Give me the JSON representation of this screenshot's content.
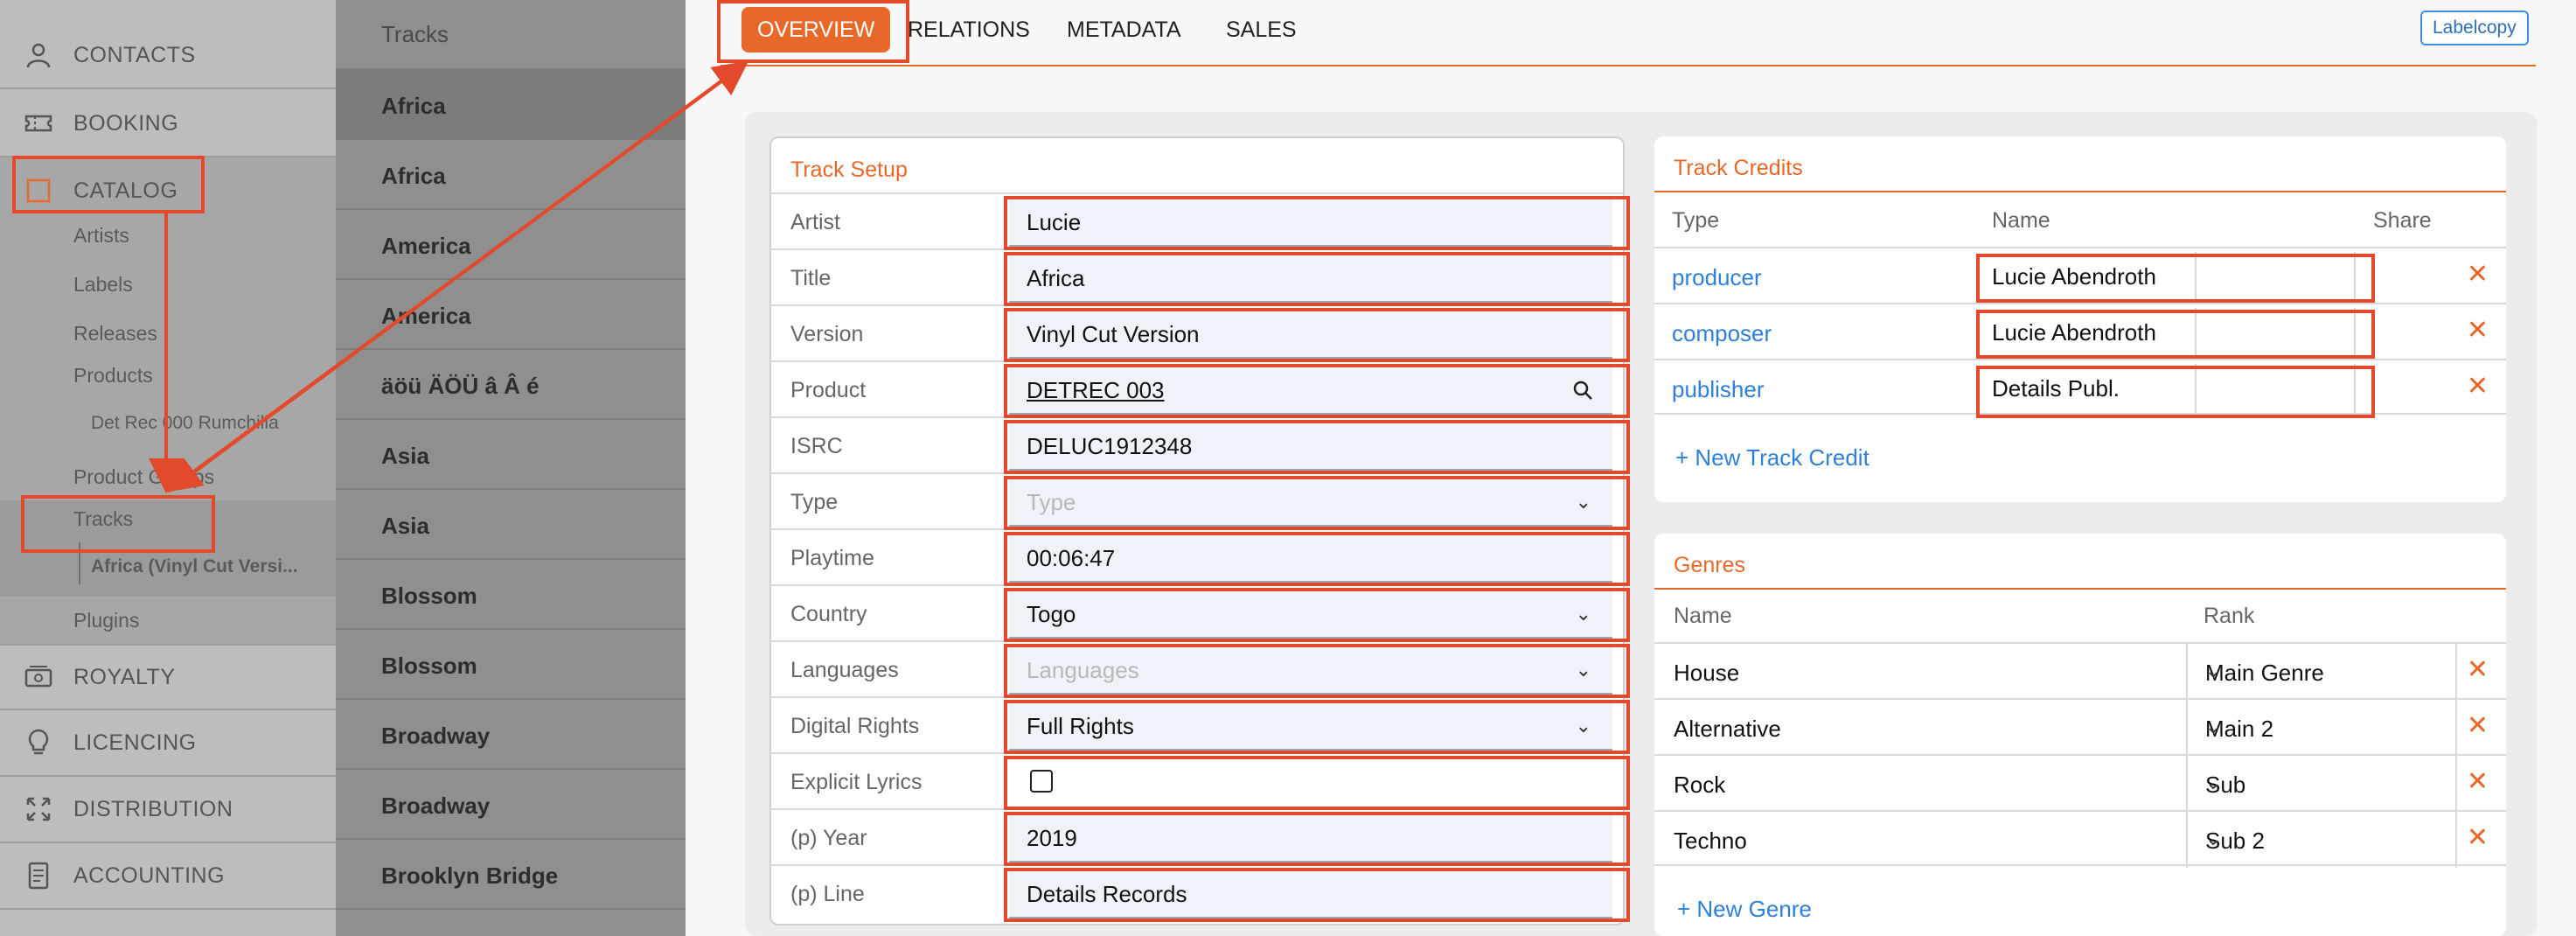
{
  "sidebar": {
    "contacts": "CONTACTS",
    "booking": "BOOKING",
    "catalog": "CATALOG",
    "catalog_items": {
      "artists": "Artists",
      "labels": "Labels",
      "releases": "Releases",
      "products": "Products",
      "product_child": "Det Rec 000 Rumchilla",
      "product_groups": "Product Groups",
      "tracks": "Tracks",
      "track_child": "Africa (Vinyl Cut Versi...",
      "plugins": "Plugins"
    },
    "royalty": "ROYALTY",
    "licencing": "LICENCING",
    "distribution": "DISTRIBUTION",
    "accounting": "ACCOUNTING"
  },
  "tracklist": {
    "header": "Tracks",
    "items": [
      "Africa",
      "Africa",
      "America",
      "America",
      "äöü ÄÖÜ â Â é",
      "Asia",
      "Asia",
      "Blossom",
      "Blossom",
      "Broadway",
      "Broadway",
      "Brooklyn Bridge"
    ]
  },
  "tabs": {
    "overview": "OVERVIEW",
    "relations": "RELATIONS",
    "metadata": "METADATA",
    "sales": "SALES"
  },
  "labelcopy": "Labelcopy",
  "track_setup": {
    "title": "Track Setup",
    "fields": {
      "artist": {
        "label": "Artist",
        "value": "Lucie"
      },
      "title": {
        "label": "Title",
        "value": "Africa"
      },
      "version": {
        "label": "Version",
        "value": "Vinyl Cut Version"
      },
      "product": {
        "label": "Product",
        "value": "DETREC 003"
      },
      "isrc": {
        "label": "ISRC",
        "value": "DELUC1912348"
      },
      "type": {
        "label": "Type",
        "placeholder": "Type"
      },
      "playtime": {
        "label": "Playtime",
        "value": "00:06:47"
      },
      "country": {
        "label": "Country",
        "value": "Togo"
      },
      "languages": {
        "label": "Languages",
        "placeholder": "Languages"
      },
      "digital_rights": {
        "label": "Digital Rights",
        "value": "Full Rights"
      },
      "explicit": {
        "label": "Explicit Lyrics",
        "checked": false
      },
      "p_year": {
        "label": "(p) Year",
        "value": "2019"
      },
      "p_line": {
        "label": "(p) Line",
        "value": "Details Records"
      }
    }
  },
  "track_credits": {
    "title": "Track Credits",
    "columns": {
      "type": "Type",
      "name": "Name",
      "share": "Share"
    },
    "rows": [
      {
        "type": "producer",
        "name": "Lucie Abendroth"
      },
      {
        "type": "composer",
        "name": "Lucie Abendroth"
      },
      {
        "type": "publisher",
        "name": "Details Publ."
      }
    ],
    "add_label": "+ New Track Credit"
  },
  "genres": {
    "title": "Genres",
    "columns": {
      "name": "Name",
      "rank": "Rank"
    },
    "rows": [
      {
        "name": "House",
        "rank": "Main Genre"
      },
      {
        "name": "Alternative",
        "rank": "Main 2"
      },
      {
        "name": "Rock",
        "rank": "Sub"
      },
      {
        "name": "Techno",
        "rank": "Sub 2"
      }
    ],
    "add_label": "+ New Genre"
  },
  "colors": {
    "accent": "#e8682a",
    "link": "#2d7fd8",
    "annotation": "#e34a2b"
  }
}
